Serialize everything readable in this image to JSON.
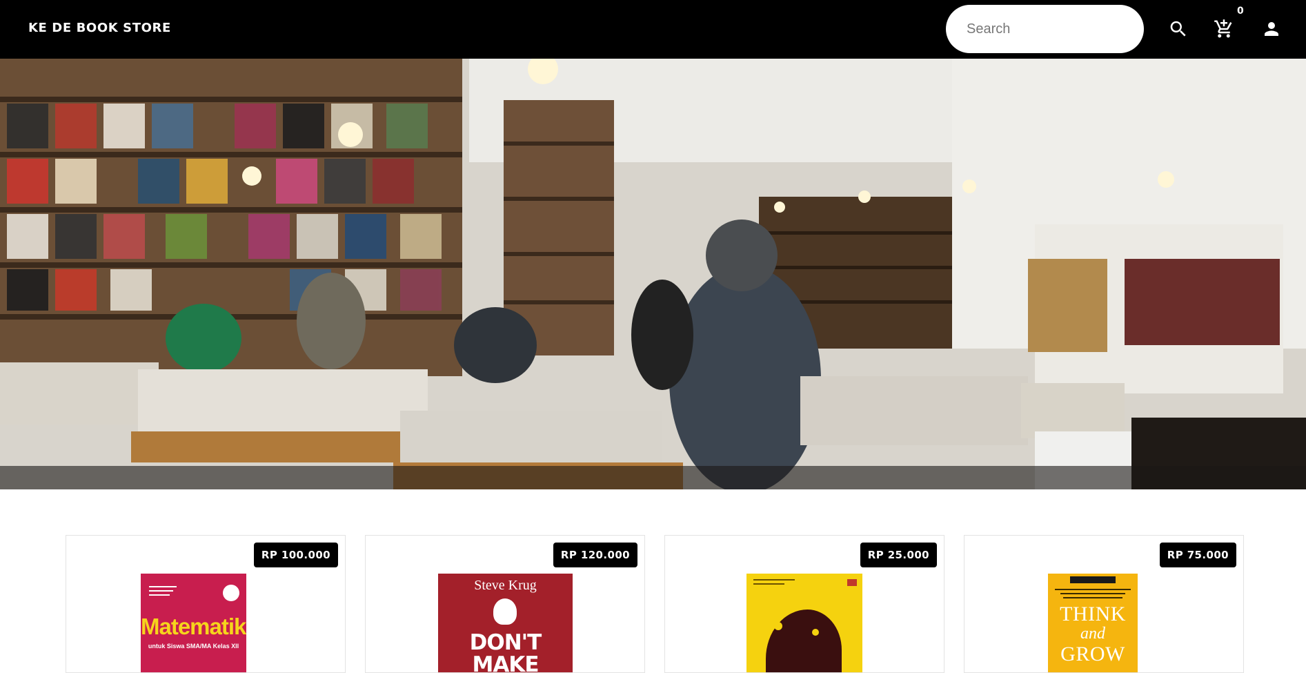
{
  "header": {
    "brand": "KE DE BOOK STORE",
    "search_placeholder": "Search",
    "cart_count": "0",
    "icons": [
      "search-icon",
      "cart-add-icon",
      "account-icon"
    ]
  },
  "hero": {
    "slide_count": 5,
    "active_slide": 1
  },
  "products": [
    {
      "price": "RP 100.000",
      "cover_title": "Matematika",
      "cover_subtitle": "untuk Siswa SMA/MA Kelas XII",
      "cover_color": "#c81e4e"
    },
    {
      "price": "RP 120.000",
      "cover_author": "Steve Krug",
      "cover_title": "DON'T",
      "cover_title_2": "MAKE",
      "cover_color": "#a3202a"
    },
    {
      "price": "RP 25.000",
      "cover_color": "#f5d20f"
    },
    {
      "price": "RP 75.000",
      "cover_title": "THINK",
      "cover_title_2": "and",
      "cover_title_3": "GROW",
      "cover_color": "#f5b50f"
    }
  ],
  "colors": {
    "header_bg": "#000000",
    "price_badge_bg": "#000000"
  }
}
